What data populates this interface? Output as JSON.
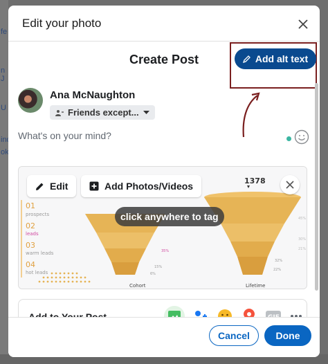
{
  "dialog": {
    "title": "Edit your photo",
    "alt_text_button": "Add alt text",
    "cancel_label": "Cancel",
    "done_label": "Done"
  },
  "post": {
    "title": "Create Post",
    "author_name": "Ana McNaughton",
    "audience": "Friends except...",
    "placeholder": "What's on your mind?"
  },
  "photo": {
    "edit_label": "Edit",
    "add_photos_label": "Add Photos/Videos",
    "tag_hint": "click anywhere to tag",
    "image_text": {
      "big_number": "1378",
      "steps": [
        {
          "num": "01",
          "label": "prospects"
        },
        {
          "num": "02",
          "label": "leads"
        },
        {
          "num": "03",
          "label": "warm leads"
        },
        {
          "num": "04",
          "label": "hot leads"
        }
      ],
      "funnel_left_label": "Cohort",
      "funnel_right_label": "Lifetime",
      "left_values": [
        "35%",
        "15%",
        "6%"
      ],
      "right_values": [
        "32%",
        "22%"
      ],
      "right_side_values": [
        "45%",
        "30%",
        "21%"
      ]
    }
  },
  "add_to_post": {
    "label": "Add to Your Post",
    "tools": [
      "photo-video",
      "tag-people",
      "feeling",
      "check-in",
      "gif",
      "more"
    ]
  },
  "background": {
    "left_edge_text": [
      "fe",
      "n J",
      "U",
      "ind",
      "ok"
    ]
  },
  "colors": {
    "primary": "#0a66c2",
    "alt_button": "#0a4a8f",
    "annotation": "#7a1f1f",
    "funnel": "#e8b75a"
  }
}
